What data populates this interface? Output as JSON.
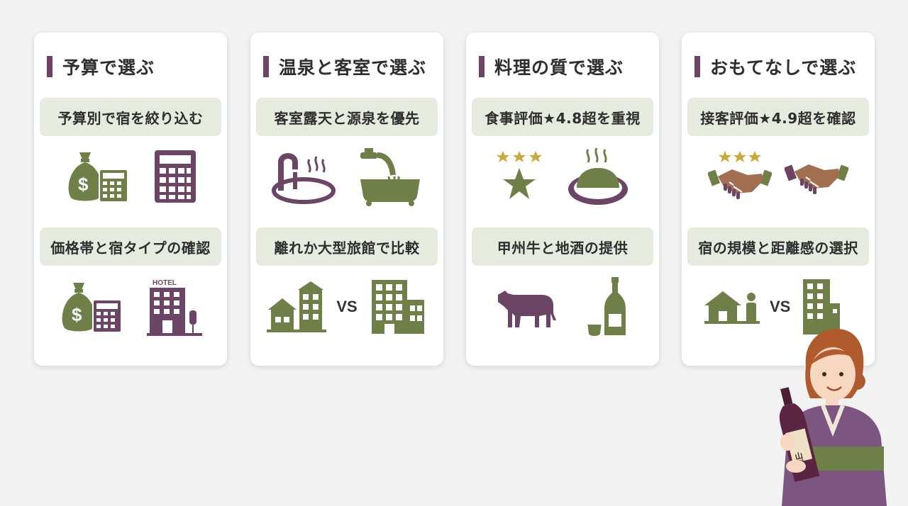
{
  "colors": {
    "accent_purple": "#6b4466",
    "icon_green": "#6e8048",
    "star_gold": "#c9a93a",
    "pill_bg": "#e6ebdf",
    "page_bg": "#f2f2f2"
  },
  "cards": [
    {
      "title": "予算で選ぶ",
      "pill1": "予算別で宿を絞り込む",
      "pill2": "価格帯と宿タイプの確認",
      "icons1": [
        "money-bag-icon",
        "calculator-icon"
      ],
      "icons2": [
        "money-bag-calculator-icon",
        "hotel-building-icon"
      ]
    },
    {
      "title": "温泉と客室で選ぶ",
      "pill1": "客室露天と源泉を優先",
      "pill2": "離れか大型旅館で比較",
      "icons1": [
        "hot-spring-icon",
        "bathtub-faucet-icon"
      ],
      "icons2": [
        "small-buildings-icon",
        "large-building-icon"
      ],
      "vs": "VS"
    },
    {
      "title": "料理の質で選ぶ",
      "pill1": "食事評価★4.8超を重視",
      "pill2": "甲州牛と地酒の提供",
      "icons1": [
        "star-rating-icon",
        "dish-icon"
      ],
      "icons2": [
        "cow-icon",
        "sake-bottle-icon"
      ]
    },
    {
      "title": "おもてなしで選ぶ",
      "pill1": "接客評価★4.9超を確認",
      "pill2": "宿の規模と距離感の選択",
      "icons1": [
        "handshake-stars-icon",
        "handshake-icon"
      ],
      "icons2": [
        "house-person-icon",
        "tall-building-icon"
      ],
      "vs": "VS"
    }
  ],
  "illustration": {
    "bottle_label": "山梨"
  }
}
